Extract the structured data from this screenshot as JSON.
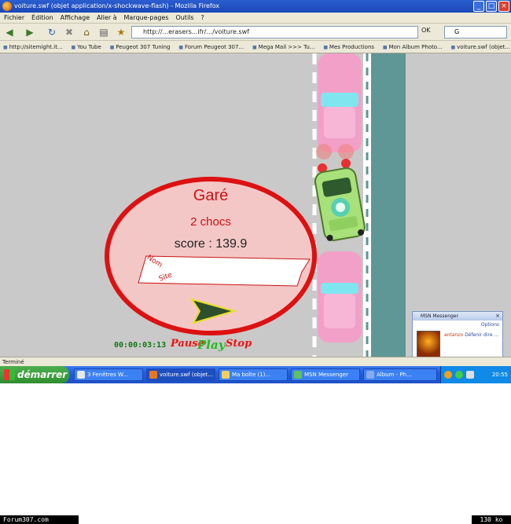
{
  "window": {
    "title": "voiture.swf (objet application/x-shockwave-flash) - Mozilla Firefox",
    "minimize": "_",
    "maximize": "□",
    "close": "×"
  },
  "menu": [
    "Fichier",
    "Édition",
    "Affichage",
    "Aller à",
    "Marque-pages",
    "Outils",
    "?"
  ],
  "nav": {
    "url": "http://...erasers...ifr/.../voiture.swf",
    "go_label": "OK",
    "search_value": "G"
  },
  "bookmarks": [
    "http://sitemight.it...",
    "You Tube",
    "Peugeot 307 Tuning",
    "Forum Peugeot 307...",
    "Mega Mail >>> Tu...",
    "Mes Productions",
    "Mon Album Photo...",
    "voiture.swf (objet...)"
  ],
  "game": {
    "result_title": "Garé",
    "collisions": "2 chocs",
    "score_text": "score : 139.9",
    "name_label": "Nom",
    "site_label": "Site",
    "timer": "00:00:03:13",
    "pause_label": "Pause",
    "play_label": "Play",
    "stop_label": "Stop"
  },
  "msn": {
    "header": "MSN Messenger",
    "options": "Options",
    "contact": "antanzo",
    "message": "Défenir dire ...",
    "brand": "msn"
  },
  "status": "Terminé",
  "taskbar": {
    "start_label": "démarrer",
    "tasks": [
      "3 Fenêtres W...",
      "voiture.swf (objet...",
      "Ma boîte (1)...",
      "MSN Messenger",
      "Album - Ph..."
    ],
    "clock": "20:55"
  },
  "footer": {
    "site": "Forum307.com",
    "size": "130 ko"
  },
  "colors": {
    "accent": "#cc1111",
    "road": "#c9c9c9",
    "water": "#5f9696",
    "pink_car": "#f2a0c8",
    "player_car": "#a8e07a"
  }
}
